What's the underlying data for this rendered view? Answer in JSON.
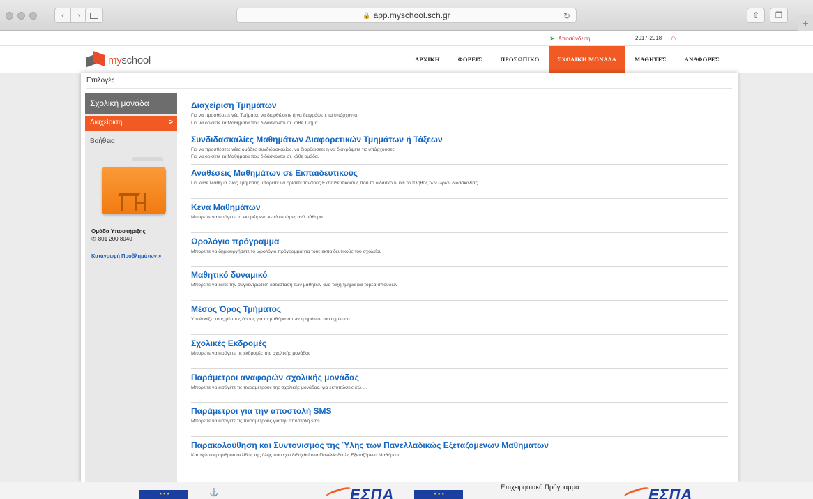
{
  "browser": {
    "url": "app.myschool.sch.gr"
  },
  "topstrip": {
    "logout_label": "Αποσύνδεση",
    "school_year": "2017-2018"
  },
  "header": {
    "logo_prefix": "my",
    "logo_suffix": "school",
    "nav": [
      {
        "label": "ΑΡΧΙΚΗ",
        "active": false
      },
      {
        "label": "ΦΟΡΕΙΣ",
        "active": false
      },
      {
        "label": "ΠΡΟΣΩΠΙΚΟ",
        "active": false
      },
      {
        "label": "ΣΧΟΛΙΚΗ ΜΟΝΑΔΑ",
        "active": true
      },
      {
        "label": "ΜΑΘΗΤΕΣ",
        "active": false
      },
      {
        "label": "ΑΝΑΦΟΡΕΣ",
        "active": false
      }
    ]
  },
  "page": {
    "options_label": "Επιλογές"
  },
  "sidebar": {
    "title": "Σχολική μονάδα",
    "selected_item": "Διαχείριση",
    "help_item": "Βοήθεια",
    "support_title": "Ομάδα Υποστήριξης",
    "support_phone": "801 200 8040",
    "report_link": "Καταγραφή Προβλημάτων »"
  },
  "entries": [
    {
      "title": "Διαχείριση Τμημάτων",
      "desc": [
        "Για να προσθέσετε νέα Τμήματα, να διορθώσετε ή να διαγράψετε τα υπάρχοντα.",
        "Για να ορίσετε τα Μαθήματα που διδάσκονται σε κάθε Τμήμα."
      ]
    },
    {
      "title": "Συνδιδασκαλίες Μαθημάτων Διαφορετικών Τμημάτων ή Τάξεων",
      "desc": [
        "Για να προσθέσετε νέες ομάδες συνδιδασκαλίας, να διορθώσετε ή να διαγράψετε τις υπάρχουσες.",
        "Για να ορίσετε τα Μαθήματα που διδάσκονται σε κάθε ομάδα."
      ]
    },
    {
      "title": "Αναθέσεις Μαθημάτων σε Εκπαιδευτικούς",
      "desc": [
        "Για κάθε Μάθημα ενός Τμήματος μπορείτε να ορίσετε τον/τους Εκπαιδευτικό/ούς που το διδάσκουν και το πλήθος των ωρών διδασκαλίας"
      ]
    },
    {
      "title": "Κενά Μαθημάτων",
      "desc": [
        "Μπορείτε να εισάγετε τα εκτιμώμενα κενά σε ώρες ανά μάθημα."
      ]
    },
    {
      "title": "Ωρολόγιο πρόγραμμα",
      "desc": [
        "Μπορείτε να δημιουργήσετε το ωρολόγιο πρόγραμμα για τους εκπαιδευτικούς του σχολείου"
      ]
    },
    {
      "title": "Μαθητικό δυναμικό",
      "desc": [
        "Μπορείτε να δείτε την συγκεντρωτική κατάσταση των μαθητών ανά τάξη,τμήμα και τομέα σπουδών"
      ]
    },
    {
      "title": "Μέσος Όρος Τμήματος",
      "desc": [
        "Υπολογίζει τους μέσους όρους για τα μαθήματα των τμημάτων του σχολείου"
      ]
    },
    {
      "title": "Σχολικές Εκδρομές",
      "desc": [
        "Μπορείτε να εισάγετε τις εκδρομές της σχολικής μονάδας"
      ]
    },
    {
      "title": "Παράμετροι αναφορών σχολικής μονάδας",
      "desc": [
        "Μπορείτε να εισάγετε τις παραμέτρους της σχολικής μονάδας, για εκτυπώσεις κτλ ..."
      ]
    },
    {
      "title": "Παράμετροι για την αποστολή SMS",
      "desc": [
        "Μπορείτε να εισάγετε τις παραμέτρους για την αποστολή sms"
      ]
    },
    {
      "title": "Παρακολούθηση και Συντονισμός της Ύλης των Πανελλαδικώς Εξεταζόμενων Μαθημάτων",
      "desc": [
        "Καταχώριση αριθμού σελίδας της ύλης που έχει διδαχθεί στα Πανελλαδικώς Εξεταζόμενα Μαθήματα"
      ]
    }
  ],
  "footer": {
    "espa_label": "ΕΣΠΑ",
    "program_label": "Επιχειρησιακό Πρόγραμμα"
  },
  "colors": {
    "accent": "#f15a22",
    "link": "#1566c0"
  }
}
